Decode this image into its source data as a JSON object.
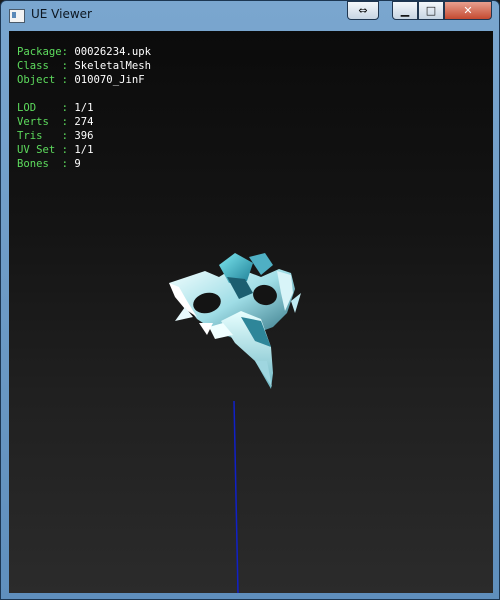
{
  "window": {
    "title": "UE Viewer",
    "buttons": {
      "switch": "⇔",
      "minimize": "▁",
      "maximize": "□",
      "close": "✕"
    }
  },
  "info": {
    "package_label": "Package:",
    "package": "00026234.upk",
    "class_label": "Class  :",
    "class": "SkeletalMesh",
    "object_label": "Object :",
    "object": "010070_JinF",
    "lod_label": "LOD    :",
    "lod": "1/1",
    "verts_label": "Verts  :",
    "verts": "274",
    "tris_label": "Tris   :",
    "tris": "396",
    "uvset_label": "UV Set :",
    "uvset": "1/1",
    "bones_label": "Bones  :",
    "bones": "9"
  },
  "colors": {
    "label": "#5ddb5d",
    "value": "#ffffff",
    "axis": "#1020c8",
    "mesh_highlight": "#7ee8f0"
  }
}
